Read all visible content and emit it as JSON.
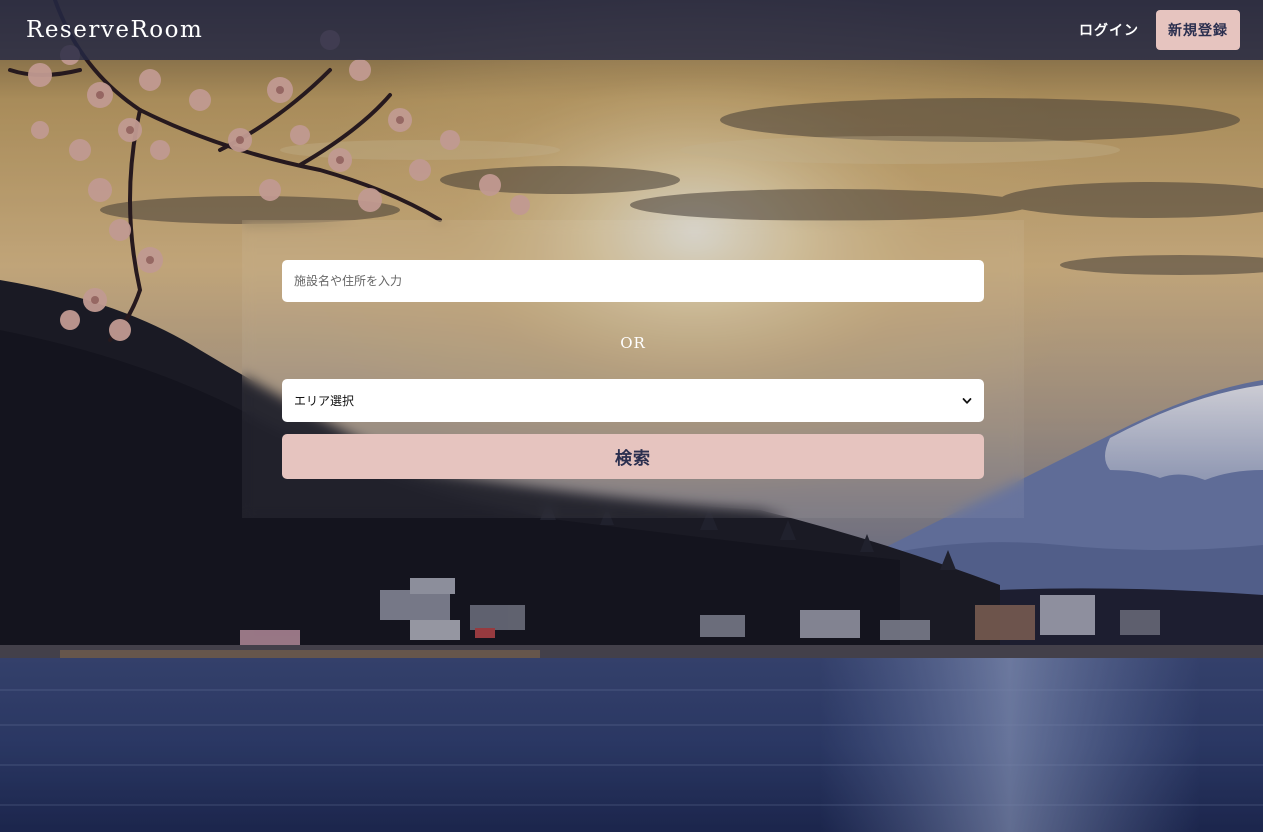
{
  "header": {
    "brand": "ReserveRoom",
    "login_label": "ログイン",
    "register_label": "新規登録"
  },
  "search": {
    "keyword_placeholder": "施設名や住所を入力",
    "keyword_value": "",
    "or_label": "OR",
    "area_selected": "エリア選択",
    "submit_label": "検索"
  },
  "icons": {
    "area_dropdown": "chevron-down-icon"
  },
  "colors": {
    "navbar_bg": "#242844",
    "accent_button": "#e6c4bf",
    "button_text": "#2b2f4f",
    "white": "#ffffff"
  }
}
